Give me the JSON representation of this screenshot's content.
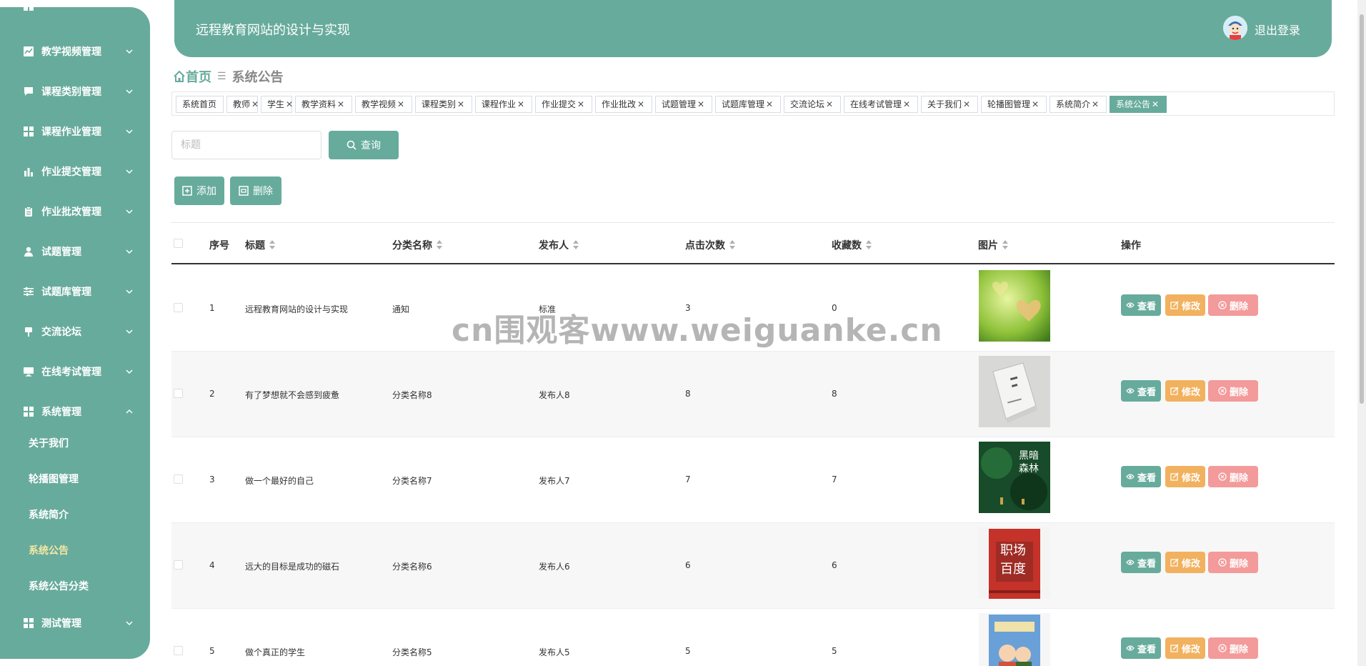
{
  "header": {
    "title": "远程教育网站的设计与实现",
    "logout": "退出登录"
  },
  "sidebar": {
    "items": [
      {
        "label": "教学视频管理",
        "icon": "chart-icon"
      },
      {
        "label": "课程类别管理",
        "icon": "chat-icon"
      },
      {
        "label": "课程作业管理",
        "icon": "grid-icon"
      },
      {
        "label": "作业提交管理",
        "icon": "bar-chart-icon"
      },
      {
        "label": "作业批改管理",
        "icon": "clipboard-icon"
      },
      {
        "label": "试题管理",
        "icon": "user-icon"
      },
      {
        "label": "试题库管理",
        "icon": "sliders-icon"
      },
      {
        "label": "交流论坛",
        "icon": "pin-icon"
      },
      {
        "label": "在线考试管理",
        "icon": "monitor-icon"
      },
      {
        "label": "系统管理",
        "icon": "grid-icon"
      },
      {
        "label": "测试管理",
        "icon": "grid-icon"
      }
    ],
    "subitems": [
      "关于我们",
      "轮播图管理",
      "系统简介",
      "系统公告",
      "系统公告分类"
    ],
    "active_sub": "系统公告"
  },
  "breadcrumb": {
    "home": "首页",
    "current": "系统公告"
  },
  "tags": [
    "系统首页",
    "教师",
    "学生",
    "教学资料",
    "教学视频",
    "课程类别",
    "课程作业",
    "作业提交",
    "作业批改",
    "试题管理",
    "试题库管理",
    "交流论坛",
    "在线考试管理",
    "关于我们",
    "轮播图管理",
    "系统简介",
    "系统公告"
  ],
  "search": {
    "placeholder": "标题",
    "query_label": "查询"
  },
  "toolbar": {
    "add_label": "添加",
    "delete_label": "删除"
  },
  "table": {
    "columns": [
      "序号",
      "标题",
      "分类名称",
      "发布人",
      "点击次数",
      "收藏数",
      "图片",
      "操作"
    ],
    "rows": [
      {
        "no": "1",
        "title": "远程教育网站的设计与实现",
        "category": "通知",
        "publisher": "标准",
        "clicks": "3",
        "favorites": "0",
        "image": "heart-leaf-photo"
      },
      {
        "no": "2",
        "title": "有了梦想就不会感到疲惫",
        "category": "分类名称8",
        "publisher": "发布人8",
        "clicks": "8",
        "favorites": "8",
        "image": "white-book-photo"
      },
      {
        "no": "3",
        "title": "做一个最好的自己",
        "category": "分类名称7",
        "publisher": "发布人7",
        "clicks": "7",
        "favorites": "7",
        "image": "dark-forest-book-photo"
      },
      {
        "no": "4",
        "title": "远大的目标是成功的磁石",
        "category": "分类名称6",
        "publisher": "发布人6",
        "clicks": "6",
        "favorites": "6",
        "image": "red-book-photo"
      },
      {
        "no": "5",
        "title": "做个真正的学生",
        "category": "分类名称5",
        "publisher": "发布人5",
        "clicks": "5",
        "favorites": "5",
        "image": "comic-book-photo"
      }
    ],
    "actions": {
      "view": "查看",
      "edit": "修改",
      "delete": "删除"
    }
  },
  "watermark": "cn围观客www.weiguanke.cn",
  "colors": {
    "primary": "#67ab9c",
    "edit": "#f2b15e",
    "delete": "#f39a9a",
    "active_sub": "#f6e8a3"
  }
}
